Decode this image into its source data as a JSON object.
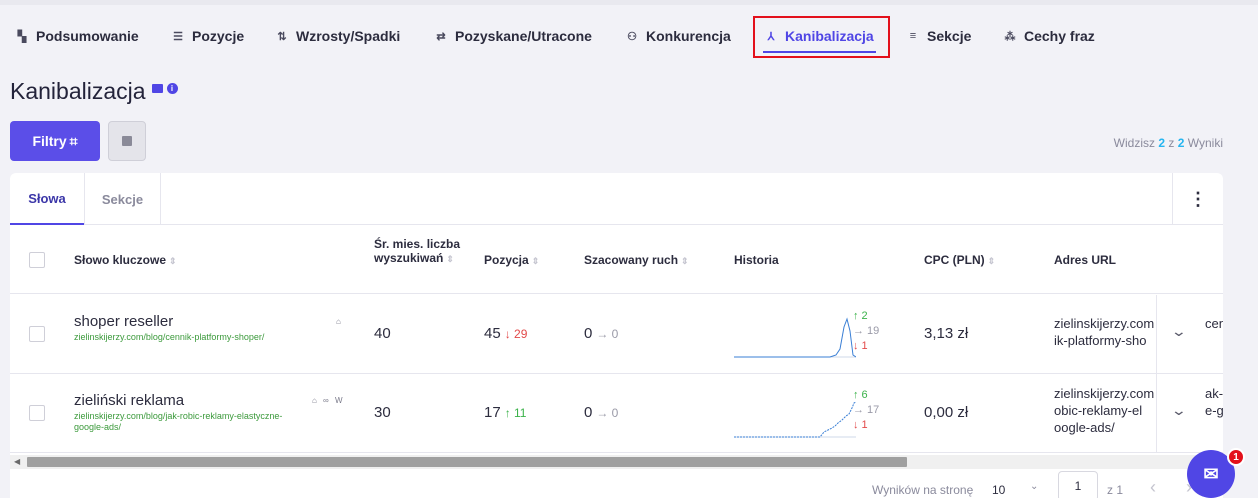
{
  "nav": {
    "items": [
      {
        "label": "Podsumowanie",
        "icon": "dashboard-icon"
      },
      {
        "label": "Pozycje",
        "icon": "list-icon"
      },
      {
        "label": "Wzrosty/Spadki",
        "icon": "up-down-arrows-icon"
      },
      {
        "label": "Pozyskane/Utracone",
        "icon": "swap-arrows-icon"
      },
      {
        "label": "Konkurencja",
        "icon": "users-icon"
      },
      {
        "label": "Kanibalizacja",
        "icon": "merge-icon"
      },
      {
        "label": "Sekcje",
        "icon": "sections-icon"
      },
      {
        "label": "Cechy fraz",
        "icon": "shapes-icon"
      }
    ],
    "active": "Kanibalizacja",
    "active_color": "#5046e5",
    "highlight_color": "#e3101b"
  },
  "page": {
    "title": "Kanibalizacja"
  },
  "toolbar": {
    "filters_label": "Filtry",
    "filters_icon": "⌗"
  },
  "results": {
    "prefix": "Widzisz",
    "shown": "2",
    "of_label": "z",
    "total": "2",
    "suffix": "Wyniki"
  },
  "subtabs": {
    "items": [
      "Słowa",
      "Sekcje"
    ],
    "active": "Słowa",
    "more": "⋮"
  },
  "columns": {
    "keyword": "Słowo kluczowe",
    "volume": "Śr. mies. liczba wyszukiwań",
    "position": "Pozycja",
    "traffic": "Szacowany ruch",
    "history": "Historia",
    "cpc": "CPC (PLN)",
    "url": "Adres URL"
  },
  "rows": [
    {
      "keyword": "shoper reseller",
      "url_short": "zielinskijerzy.com/blog/cennik-platformy-shoper/",
      "icons": "⌂",
      "volume": "40",
      "position": "45",
      "position_delta": "↓ 29",
      "traffic": "0",
      "traffic_delta": "→ 0",
      "hist_up": "↑ 2",
      "hist_flat": "→ 19",
      "hist_down": "↓ 1",
      "cpc": "3,13 zł",
      "url_line1": "zielinskijerzy.com",
      "url_line2": "ik-platformy-sho",
      "overflow1": "cen",
      "overflow2": ""
    },
    {
      "keyword": "zieliński reklama",
      "url_short": "zielinskijerzy.com/blog/jak-robic-reklamy-elastyczne-google-ads/",
      "icons": "⌂ ∞ W",
      "volume": "30",
      "position": "17",
      "position_delta": "↑ 11",
      "traffic": "0",
      "traffic_delta": "→ 0",
      "hist_up": "↑ 6",
      "hist_flat": "→ 17",
      "hist_down": "↓ 1",
      "cpc": "0,00 zł",
      "url_line1": "zielinskijerzy.com",
      "url_line2": "obic-reklamy-el",
      "url_line3": "oogle-ads/",
      "overflow1": "ak-",
      "overflow2": "e-g"
    }
  ],
  "pagination": {
    "per_page_label": "Wyników na stronę",
    "per_page": "10",
    "page": "1",
    "of": "z 1"
  },
  "chat": {
    "badge": "1"
  }
}
